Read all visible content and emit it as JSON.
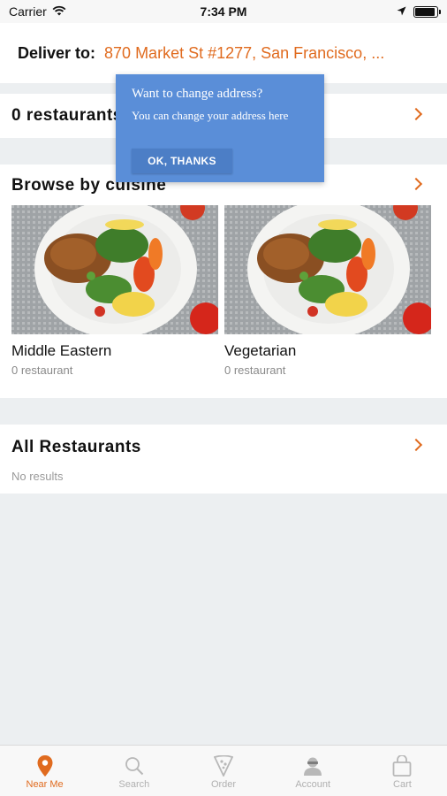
{
  "status_bar": {
    "carrier": "Carrier",
    "time": "7:34 PM",
    "battery_level": 0.9
  },
  "header": {
    "deliver_label": "Deliver to:",
    "address": "870 Market St #1277, San Francisco, ..."
  },
  "restaurants_row": {
    "title": "0 restaurants"
  },
  "tooltip": {
    "title": "Want to change address?",
    "body": "You can change your address here",
    "button_label": "OK, THANKS"
  },
  "cuisine": {
    "title": "Browse by cuisine",
    "items": [
      {
        "name": "Middle Eastern",
        "count": "0 restaurant"
      },
      {
        "name": "Vegetarian",
        "count": "0 restaurant"
      }
    ]
  },
  "all_restaurants": {
    "title": "All Restaurants",
    "empty_text": "No results"
  },
  "tab_bar": {
    "items": [
      {
        "label": "Near Me",
        "icon": "location-pin-icon",
        "active": true
      },
      {
        "label": "Search",
        "icon": "search-icon",
        "active": false
      },
      {
        "label": "Order",
        "icon": "pizza-slice-icon",
        "active": false
      },
      {
        "label": "Account",
        "icon": "user-icon",
        "active": false
      },
      {
        "label": "Cart",
        "icon": "shopping-bag-icon",
        "active": false
      }
    ]
  },
  "colors": {
    "accent": "#e06b1f",
    "tooltip_bg": "#5a8ed8",
    "page_bg": "#eceff1",
    "tab_inactive": "#b0b0b0"
  }
}
